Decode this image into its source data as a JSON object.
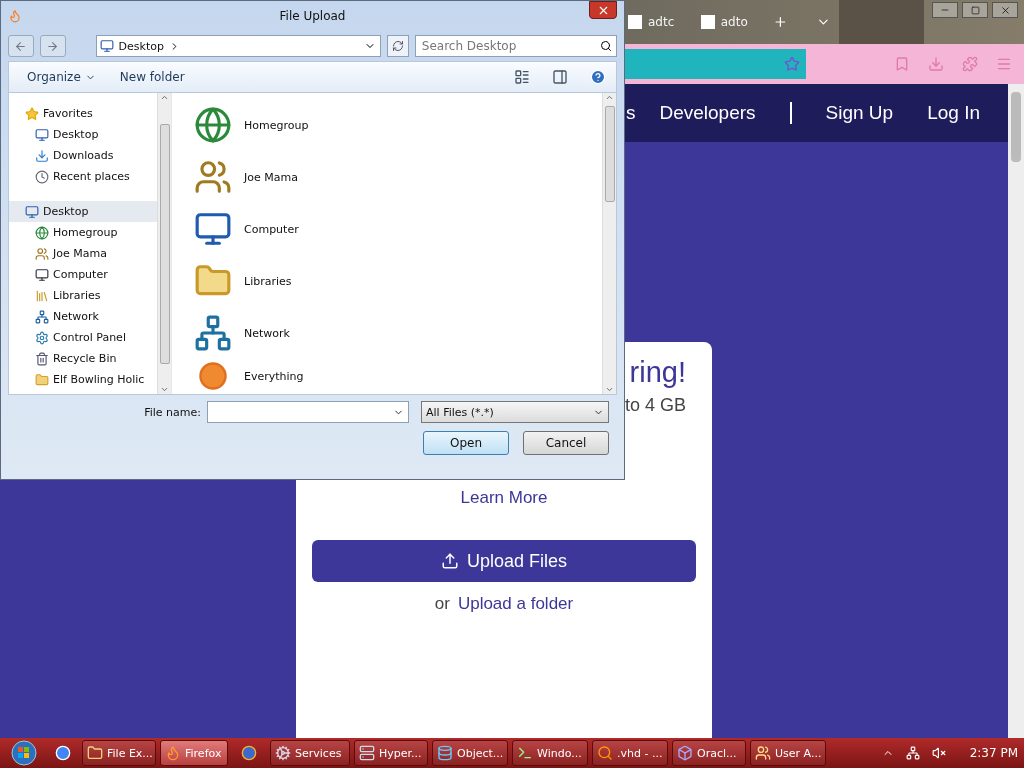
{
  "browser": {
    "tabs": [
      {
        "title": "adtc"
      },
      {
        "title": "adto"
      }
    ],
    "nav_links": [
      "s",
      "Developers",
      "Sign Up",
      "Log In"
    ],
    "card": {
      "heading": "ring!",
      "subtitle": "to 4 GB",
      "learn_more": "Learn More",
      "upload_button": "Upload Files",
      "or": "or",
      "upload_folder": "Upload a folder"
    }
  },
  "dialog": {
    "title": "File Upload",
    "address": "Desktop",
    "search": {
      "placeholder": "Search Desktop"
    },
    "organize": "Organize",
    "new_folder": "New folder",
    "nav": [
      {
        "label": "Favorites",
        "selected": false,
        "children": [
          {
            "label": "Desktop",
            "selected": false
          },
          {
            "label": "Downloads",
            "selected": false
          },
          {
            "label": "Recent places",
            "selected": false
          }
        ]
      },
      {
        "label": "Desktop",
        "selected": true,
        "children": [
          {
            "label": "Homegroup",
            "selected": false
          },
          {
            "label": "Joe Mama",
            "selected": false
          },
          {
            "label": "Computer",
            "selected": false
          },
          {
            "label": "Libraries",
            "selected": false
          },
          {
            "label": "Network",
            "selected": false
          },
          {
            "label": "Control Panel",
            "selected": false
          },
          {
            "label": "Recycle Bin",
            "selected": false
          },
          {
            "label": "Elf Bowling Holic",
            "selected": false
          }
        ]
      }
    ],
    "items": [
      "Homegroup",
      "Joe Mama",
      "Computer",
      "Libraries",
      "Network",
      "Everything"
    ],
    "file_name_label": "File name:",
    "file_type": "All Files (*.*)",
    "buttons": [
      {
        "label": "Open",
        "default": true
      },
      {
        "label": "Cancel",
        "default": false
      }
    ]
  },
  "taskbar": {
    "items": [
      {
        "kind": "pinned",
        "selected": false
      },
      {
        "kind": "window",
        "label": "File Ex...",
        "selected": false
      },
      {
        "kind": "window",
        "label": "Firefox",
        "selected": true
      },
      {
        "kind": "pinned",
        "selected": false
      },
      {
        "kind": "window",
        "label": "Services",
        "selected": false
      },
      {
        "kind": "window",
        "label": "Hyper...",
        "selected": false
      },
      {
        "kind": "window",
        "label": "Object...",
        "selected": false
      },
      {
        "kind": "window",
        "label": "Windo...",
        "selected": false
      },
      {
        "kind": "window",
        "label": ".vhd - ...",
        "selected": false
      },
      {
        "kind": "window",
        "label": "Oracl...",
        "selected": false
      },
      {
        "kind": "window",
        "label": "User A...",
        "selected": false
      }
    ],
    "time": "2:37 PM"
  }
}
